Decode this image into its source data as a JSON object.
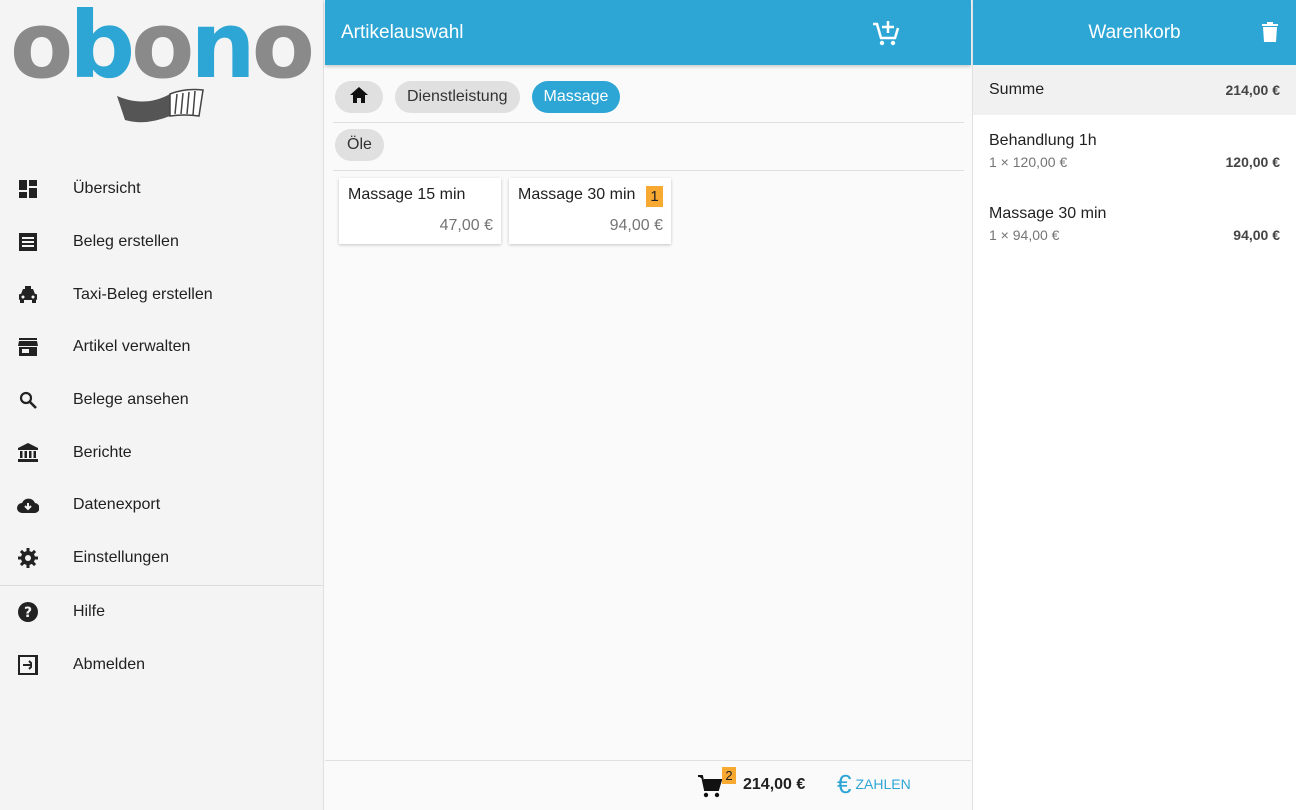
{
  "brand": {
    "logo_text_1": "o",
    "logo_text_2": "b",
    "logo_text_3": "o",
    "logo_text_4": "n",
    "logo_text_5": "o",
    "primary_color": "#2ea6d5",
    "accent_color": "#f7a932"
  },
  "sidebar": {
    "items": [
      {
        "label": "Übersicht",
        "icon": "dashboard-icon"
      },
      {
        "label": "Beleg erstellen",
        "icon": "receipt-icon"
      },
      {
        "label": "Taxi-Beleg erstellen",
        "icon": "taxi-icon"
      },
      {
        "label": "Artikel verwalten",
        "icon": "store-icon"
      },
      {
        "label": "Belege ansehen",
        "icon": "search-icon"
      },
      {
        "label": "Berichte",
        "icon": "bank-icon"
      },
      {
        "label": "Datenexport",
        "icon": "cloud-download-icon"
      },
      {
        "label": "Einstellungen",
        "icon": "gear-icon"
      },
      {
        "label": "Hilfe",
        "icon": "help-icon"
      },
      {
        "label": "Abmelden",
        "icon": "logout-icon"
      }
    ]
  },
  "article_panel": {
    "title": "Artikelauswahl",
    "breadcrumb": {
      "level1": "Dienstleistung",
      "level2": "Massage"
    },
    "subcategory": "Öle",
    "items": [
      {
        "name": "Massage 15 min",
        "price": "47,00 €",
        "qty": ""
      },
      {
        "name": "Massage 30 min",
        "price": "94,00 €",
        "qty": "1"
      }
    ],
    "footer": {
      "cart_count": "2",
      "total": "214,00 €",
      "pay_label": "ZAHLEN",
      "pay_symbol": "€"
    }
  },
  "cart": {
    "title": "Warenkorb",
    "sum_label": "Summe",
    "sum_value": "214,00 €",
    "items": [
      {
        "name": "Behandlung 1h",
        "detail": "1 × 120,00 €",
        "total": "120,00 €"
      },
      {
        "name": "Massage 30 min",
        "detail": "1 × 94,00 €",
        "total": "94,00 €"
      }
    ]
  }
}
